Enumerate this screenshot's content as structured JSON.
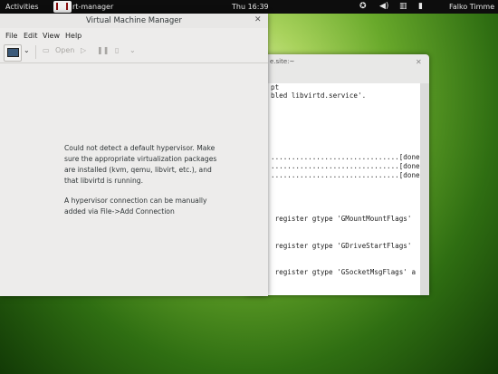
{
  "topbar": {
    "activities": "Activities",
    "app_name": "rt-manager",
    "clock": "Thu 16:39",
    "user": "Falko Timme"
  },
  "terminal": {
    "title": "e.site:~",
    "lines": [
      "pt",
      "bled libvirtd.service'.",
      "...............................[done]",
      "...............................[done]",
      "...............................[done]",
      " register gtype 'GMountMountFlags'",
      " register gtype 'GDriveStartFlags'",
      " register gtype 'GSocketMsgFlags' a"
    ]
  },
  "vmm": {
    "title": "Virtual Machine Manager",
    "menu": [
      "File",
      "Edit",
      "View",
      "Help"
    ],
    "toolbar": {
      "open_label": "Open"
    },
    "message_lines": [
      "Could not detect a default hypervisor. Make",
      "sure the appropriate virtualization packages",
      "are installed (kvm, qemu, libvirt, etc.), and",
      "that libvirtd is running.",
      "",
      "A hypervisor connection can be manually",
      "added via File->Add Connection"
    ]
  },
  "icons": {
    "accessibility": "accessibility-icon",
    "volume": "volume-icon",
    "network": "network-icon",
    "battery": "battery-icon"
  }
}
